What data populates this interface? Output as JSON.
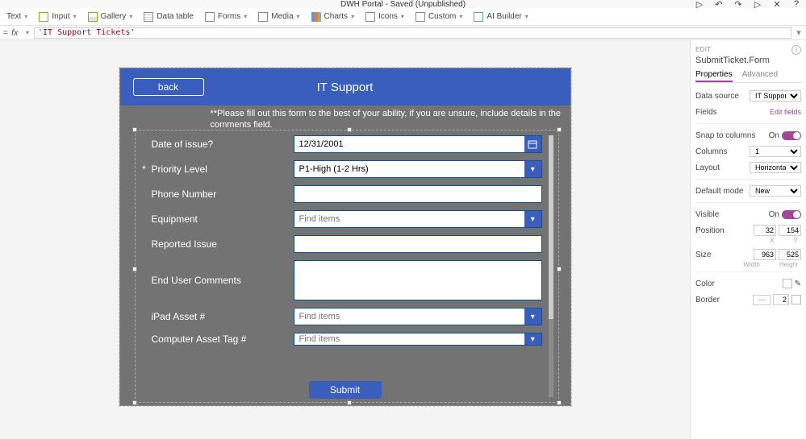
{
  "titlebar": {
    "document_title": "DWH Portal - Saved (Unpublished)"
  },
  "ribbon": {
    "text": "Text",
    "input": "Input",
    "gallery": "Gallery",
    "data_table": "Data table",
    "forms": "Forms",
    "media": "Media",
    "charts": "Charts",
    "icons": "Icons",
    "custom": "Custom",
    "ai_builder": "AI Builder"
  },
  "formula": {
    "expression": "'IT Support Tickets'"
  },
  "app": {
    "back": "back",
    "title": "IT Support",
    "instructions": "**Please fill out this form to the best of your ability, if you are unsure, include details in the comments field.",
    "submit": "Submit",
    "fields": {
      "date_label": "Date of issue?",
      "date_value": "12/31/2001",
      "priority_label": "Priority Level",
      "priority_value": "P1-High (1-2 Hrs)",
      "phone_label": "Phone Number",
      "phone_value": "",
      "equipment_label": "Equipment",
      "equipment_placeholder": "Find items",
      "reported_label": "Reported Issue",
      "reported_value": "",
      "comments_label": "End User Comments",
      "comments_value": "",
      "ipad_label": "iPad Asset #",
      "ipad_placeholder": "Find items",
      "computer_label": "Computer Asset Tag #",
      "computer_placeholder": "Find items"
    }
  },
  "props": {
    "section": "EDIT",
    "object": "SubmitTicket.Form",
    "tab_properties": "Properties",
    "tab_advanced": "Advanced",
    "rows": {
      "data_source_label": "Data source",
      "data_source_value": "IT Support Tickets",
      "fields_label": "Fields",
      "fields_link": "Edit fields",
      "snap_label": "Snap to columns",
      "snap_on": "On",
      "columns_label": "Columns",
      "columns_value": "1",
      "layout_label": "Layout",
      "layout_value": "Horizontal",
      "default_mode_label": "Default mode",
      "default_mode_value": "New",
      "visible_label": "Visible",
      "visible_on": "On",
      "position_label": "Position",
      "pos_x": "32",
      "pos_y": "154",
      "pos_x_sub": "X",
      "pos_y_sub": "Y",
      "size_label": "Size",
      "size_w": "963",
      "size_h": "525",
      "size_w_sub": "Width",
      "size_h_sub": "Height",
      "color_label": "Color",
      "border_label": "Border",
      "border_style": "—",
      "border_width": "2"
    }
  }
}
